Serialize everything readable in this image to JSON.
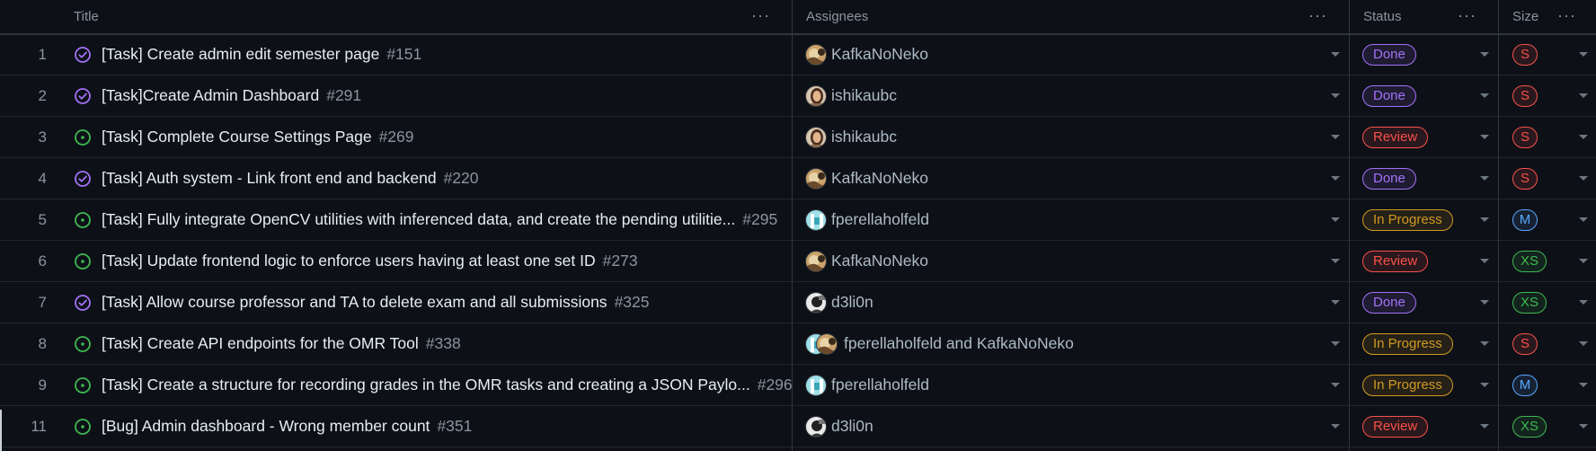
{
  "columns": {
    "title": "Title",
    "assignees": "Assignees",
    "status": "Status",
    "size": "Size",
    "menu": "···"
  },
  "rows": [
    {
      "num": "1",
      "state": "closed",
      "title": "[Task] Create admin edit semester page",
      "issue": "#151",
      "assignees": "KafkaNoNeko",
      "avatar": "kafka",
      "status": "Done",
      "size": "S"
    },
    {
      "num": "2",
      "state": "closed",
      "title": "[Task]Create Admin Dashboard",
      "issue": "#291",
      "assignees": "ishikaubc",
      "avatar": "ishika",
      "status": "Done",
      "size": "S"
    },
    {
      "num": "3",
      "state": "open",
      "title": "[Task] Complete Course Settings Page",
      "issue": "#269",
      "assignees": "ishikaubc",
      "avatar": "ishika",
      "status": "Review",
      "size": "S"
    },
    {
      "num": "4",
      "state": "closed",
      "title": "[Task] Auth system - Link front end and backend",
      "issue": "#220",
      "assignees": "KafkaNoNeko",
      "avatar": "kafka",
      "status": "Done",
      "size": "S"
    },
    {
      "num": "5",
      "state": "open",
      "title": "[Task] Fully integrate OpenCV utilities with inferenced data, and create the pending utilitie...",
      "issue": "#295",
      "assignees": "fperellaholfeld",
      "avatar": "fperella",
      "status": "In Progress",
      "size": "M"
    },
    {
      "num": "6",
      "state": "open",
      "title": "[Task] Update frontend logic to enforce users having at least one set ID",
      "issue": "#273",
      "assignees": "KafkaNoNeko",
      "avatar": "kafka",
      "status": "Review",
      "size": "XS"
    },
    {
      "num": "7",
      "state": "closed",
      "title": "[Task] Allow course professor and TA to delete exam and all submissions",
      "issue": "#325",
      "assignees": "d3li0n",
      "avatar": "d3li0n",
      "status": "Done",
      "size": "XS"
    },
    {
      "num": "8",
      "state": "open",
      "title": "[Task] Create API endpoints for the OMR Tool",
      "issue": "#338",
      "assignees": "fperellaholfeld and KafkaNoNeko",
      "avatar": "pair",
      "status": "In Progress",
      "size": "S"
    },
    {
      "num": "9",
      "state": "open",
      "title": "[Task] Create a structure for recording grades in the OMR tasks and creating a JSON Paylo...",
      "issue": "#296",
      "assignees": "fperellaholfeld",
      "avatar": "fperella",
      "status": "In Progress",
      "size": "M"
    },
    {
      "num": "11",
      "state": "open",
      "title": "[Bug] Admin dashboard - Wrong member count",
      "issue": "#351",
      "assignees": "d3li0n",
      "avatar": "d3li0n",
      "status": "Review",
      "size": "XS"
    }
  ],
  "colors": {
    "done": "#a371f7",
    "open": "#3fb950",
    "review": "#f85149",
    "inprogress": "#d29922",
    "sizeS": "#f85149",
    "sizeM": "#58a6ff",
    "sizeXS": "#3fb950"
  }
}
